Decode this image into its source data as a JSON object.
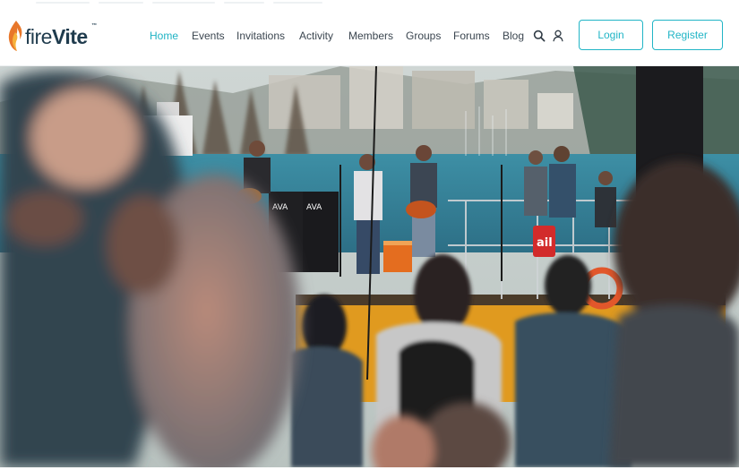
{
  "brand": {
    "name_part1": "fire",
    "name_part2": "Vite",
    "trademark": "™",
    "colors": {
      "flame_outer": "#e8772a",
      "flame_inner": "#f6b23c",
      "text": "#1f3b4d"
    }
  },
  "nav": {
    "items": [
      {
        "label": "Home",
        "active": true
      },
      {
        "label": "Events",
        "active": false
      },
      {
        "label": "Invitations",
        "active": false
      },
      {
        "label": "Activity",
        "active": false
      },
      {
        "label": "Members",
        "active": false
      },
      {
        "label": "Groups",
        "active": false
      },
      {
        "label": "Forums",
        "active": false
      },
      {
        "label": "Blog",
        "active": false
      }
    ],
    "icons": [
      "search-icon",
      "user-icon"
    ]
  },
  "auth": {
    "login_label": "Login",
    "register_label": "Register"
  },
  "hero": {
    "image": "outdoor-concert-band-on-lakeside-stage-with-audience",
    "amp_brand": "AVA",
    "sign_text": "ail"
  },
  "theme": {
    "accent": "#21b5c6",
    "nav_text": "#3b4650",
    "background": "#ffffff"
  }
}
